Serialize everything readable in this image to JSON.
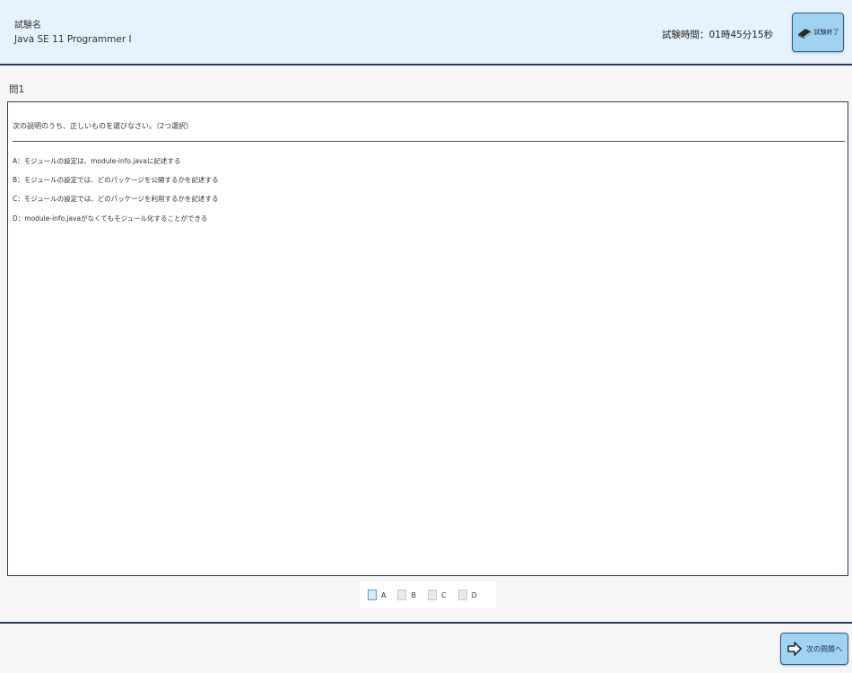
{
  "header": {
    "exam_label": "試験名",
    "exam_title": "Java SE 11 Programmer Ⅰ",
    "timer_text": "試験時間：01時45分15秒",
    "end_button_label": "試験終了",
    "end_icon": "book-icon"
  },
  "question": {
    "number": "問1",
    "instruction": "次の説明のうち、正しいものを選びなさい。（2つ選択）",
    "options": [
      "A：モジュールの設定は、module-info.javaに記述する",
      "B：モジュールの設定では、どのパッケージを公開するかを記述する",
      "C：モジュールの設定では、どのパッケージを利用するかを記述する",
      "D：module-info.javaがなくてもモジュール化することができる"
    ]
  },
  "answers": {
    "choices": [
      "A",
      "B",
      "C",
      "D"
    ]
  },
  "footer": {
    "next_button_label": "次の問題へ",
    "next_icon": "arrow-right-icon"
  },
  "colors": {
    "header_bg": "#e6f2fc",
    "button_bg": "#9fd3f1",
    "border_dark": "#2b3a55"
  }
}
